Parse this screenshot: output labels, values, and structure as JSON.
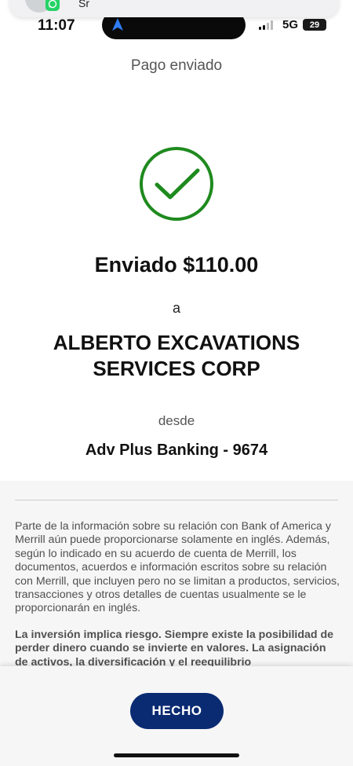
{
  "notification": {
    "app_icon": "whatsapp-icon",
    "text": "Sr"
  },
  "status_bar": {
    "time": "11:07",
    "network": "5G",
    "battery": "29"
  },
  "header": {
    "title": "Pago enviado"
  },
  "confirmation": {
    "icon": "checkmark-circle-icon",
    "icon_color": "#1e8a1e",
    "amount_text": "Enviado $110.00",
    "to_label": "a",
    "payee_line1": "ALBERTO EXCAVATIONS",
    "payee_line2": "SERVICES CORP",
    "from_label": "desde",
    "account": "Adv Plus Banking - 9674"
  },
  "disclosure": {
    "paragraph": "Parte de la información sobre su relación con Bank of America y Merrill aún puede proporcionarse solamente en inglés. Además, según lo indicado en su acuerdo de cuenta de Merrill, los documentos, acuerdos e información escritos sobre su relación con Merrill, que incluyen pero no se limitan a productos, servicios, transacciones y otros detalles de cuentas usualmente se le proporcionarán en inglés.",
    "risk_paragraph": "La inversión implica riesgo. Siempre existe la posibilidad de perder dinero cuando se invierte en valores. La asignación de activos, la diversificación y el reequilibrio"
  },
  "footer": {
    "done_label": "HECHO",
    "button_color": "#0a2a72"
  }
}
